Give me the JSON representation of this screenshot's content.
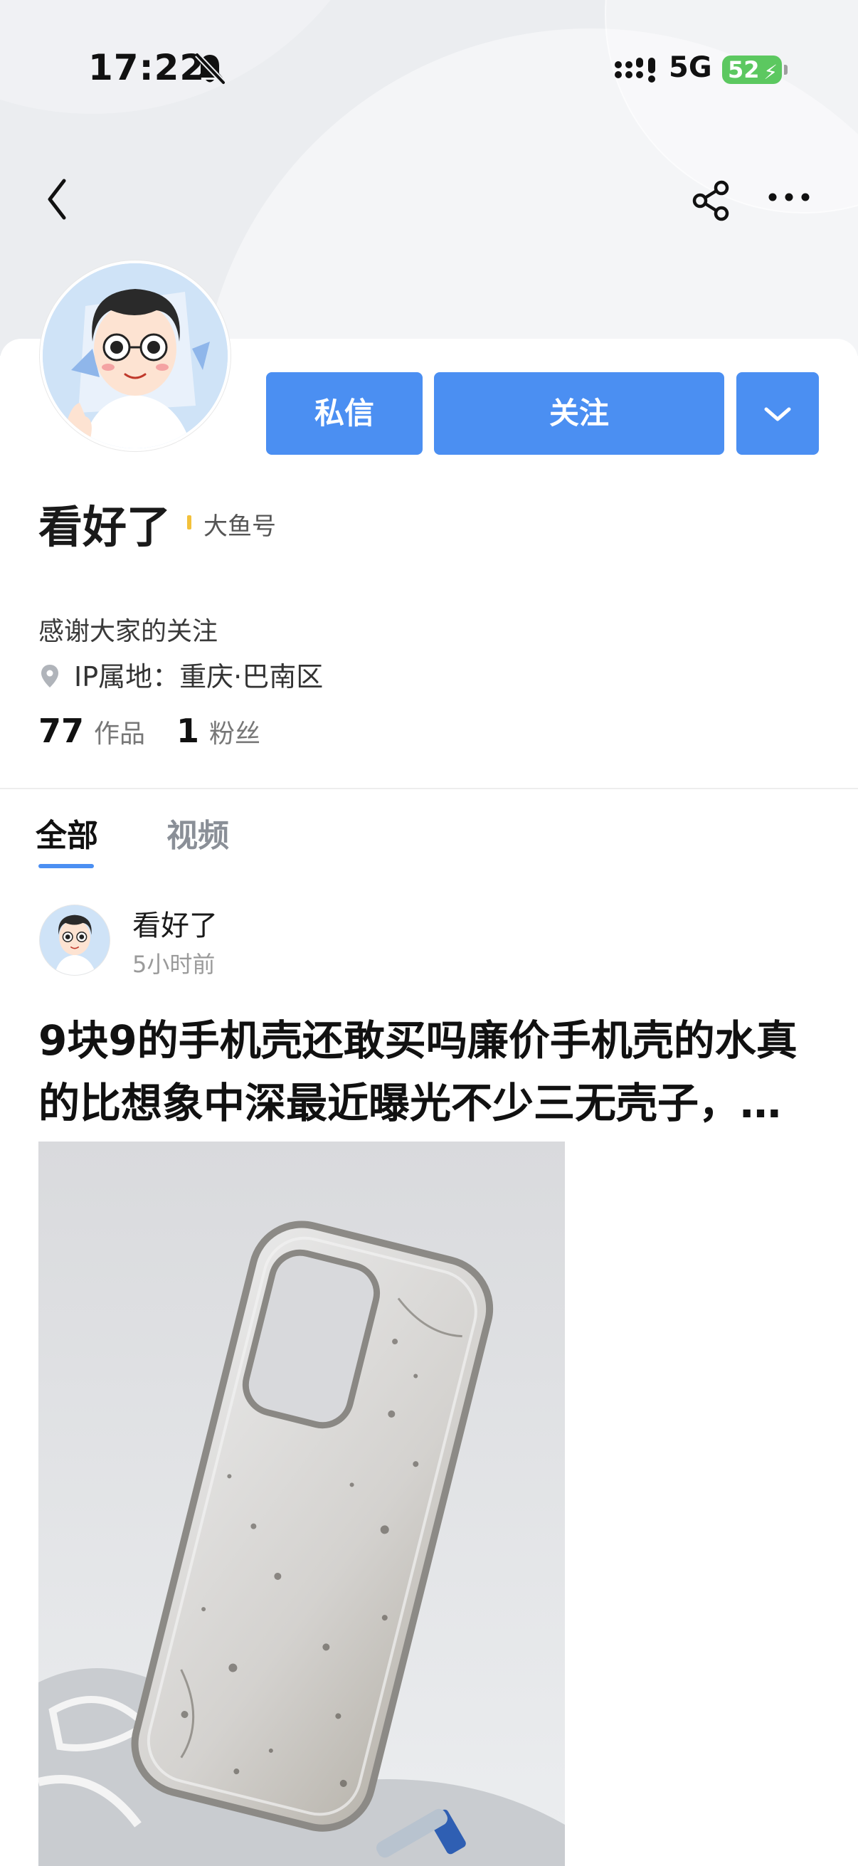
{
  "status_bar": {
    "time": "17:22",
    "network": "5G",
    "battery": "52",
    "icons": [
      "bell-muted-icon",
      "signal-icon",
      "battery-charging-icon"
    ]
  },
  "nav": {
    "icons": [
      "back-arrow-icon",
      "share-icon",
      "more-icon"
    ]
  },
  "profile": {
    "name": "看好了",
    "badge": "大鱼号",
    "bio": "感谢大家的关注",
    "ip_location": "IP属地：重庆·巴南区",
    "stats": {
      "works_count": "77",
      "works_label": "作品",
      "fans_count": "1",
      "fans_label": "粉丝"
    }
  },
  "actions": {
    "message_label": "私信",
    "follow_label": "关注"
  },
  "tabs": [
    {
      "label": "全部",
      "active": true
    },
    {
      "label": "视频",
      "active": false
    }
  ],
  "post": {
    "author": "看好了",
    "time": "5小时前",
    "title": "9块9的手机壳还敢买吗廉价手机壳的水真的比想象中深最近曝光不少三无壳子，…"
  },
  "colors": {
    "accent": "#4b8ff2",
    "battery": "#5cc860",
    "badge_divider": "#f3c13b"
  }
}
